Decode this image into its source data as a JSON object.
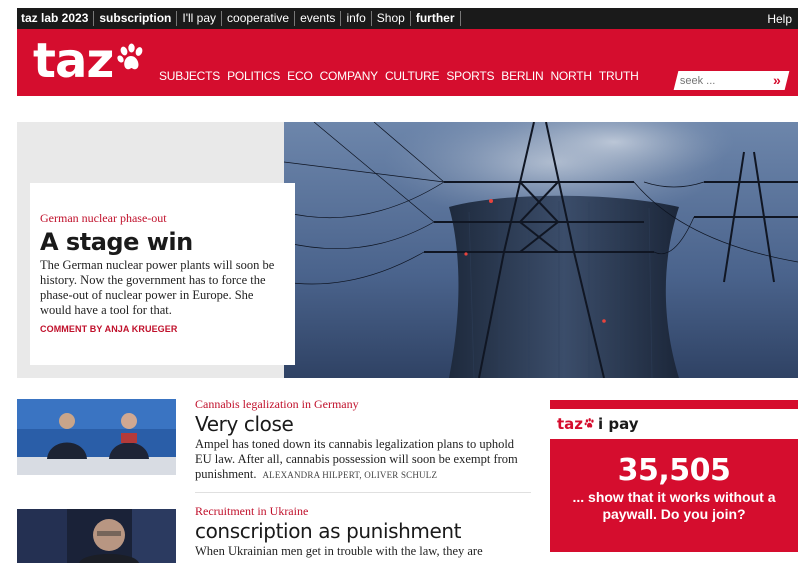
{
  "topbar": {
    "links": [
      {
        "label": "taz lab 2023",
        "bold": true
      },
      {
        "label": "subscription",
        "bold": true
      },
      {
        "label": "I'll pay",
        "bold": false
      },
      {
        "label": "cooperative",
        "bold": false
      },
      {
        "label": "events",
        "bold": false
      },
      {
        "label": "info",
        "bold": false
      },
      {
        "label": "Shop",
        "bold": false
      },
      {
        "label": "further",
        "bold": true
      }
    ],
    "help": "Help"
  },
  "header": {
    "logo": "taz",
    "logo_icon": "paw-icon",
    "nav": [
      "SUBJECTS",
      "POLITICS",
      "ECO",
      "COMPANY",
      "CULTURE",
      "SPORTS",
      "BERLIN",
      "NORTH",
      "TRUTH"
    ],
    "search_placeholder": "seek ...",
    "search_button": "»",
    "brand_color": "#d50d2e"
  },
  "hero": {
    "kicker": "German nuclear phase-out",
    "title": "A stage win",
    "text": "The German nuclear power plants will soon be history. Now the government has to force the phase-out of nuclear power in Europe. She would have a tool for that.",
    "byline": "COMMENT BY ANJA KRUEGER"
  },
  "articles": [
    {
      "kicker": "Cannabis legalization in Germany",
      "title": "Very close",
      "text": "Ampel has toned down its cannabis legalization plans to uphold EU law. After all, cannabis possession will soon be exempt from punishment.",
      "authors": "ALEXANDRA HILPERT, OLIVER SCHULZ"
    },
    {
      "kicker": "Recruitment in Ukraine",
      "title": "conscription as punishment",
      "text": "When Ukrainian men get in trouble with the law, they are"
    }
  ],
  "pay": {
    "logo": "taz",
    "label": "i pay",
    "count": "35,505",
    "text": "... show that it works without a paywall. Do you join?"
  }
}
